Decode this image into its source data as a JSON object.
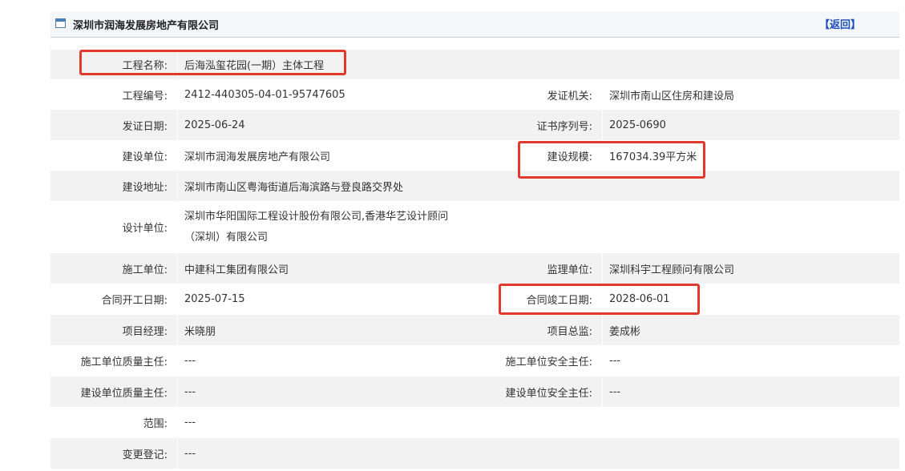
{
  "header": {
    "title": "深圳市润海发展房地产有限公司",
    "back_label": "【返回】"
  },
  "rows": [
    {
      "label1": "工程名称:",
      "value1": "后海泓玺花园(一期）主体工程"
    },
    {
      "label1": "工程编号:",
      "value1": "2412-440305-04-01-95747605",
      "label2": "发证机关:",
      "value2": "深圳市南山区住房和建设局"
    },
    {
      "label1": "发证日期:",
      "value1": "2025-06-24",
      "label2": "证书序列号:",
      "value2": "2025-0690"
    },
    {
      "label1": "建设单位:",
      "value1": "深圳市润海发展房地产有限公司",
      "label2": "建设规模:",
      "value2": "167034.39平方米"
    },
    {
      "label1": "建设地址:",
      "value1": "深圳市南山区粤海街道后海滨路与登良路交界处"
    },
    {
      "label1": "设计单位:",
      "value1_line1": "深圳市华阳国际工程设计股份有限公司,香港华艺设计顾问",
      "value1_line2": "（深圳）有限公司"
    },
    {
      "label1": "施工单位:",
      "value1": "中建科工集团有限公司",
      "label2": "监理单位:",
      "value2": "深圳科宇工程顾问有限公司"
    },
    {
      "label1": "合同开工日期:",
      "value1": "2025-07-15",
      "label2": "合同竣工日期:",
      "value2": "2028-06-01"
    },
    {
      "label1": "项目经理:",
      "value1": "米晓朋",
      "label2": "项目总监:",
      "value2": "姜成彬"
    },
    {
      "label1": "施工单位质量主任:",
      "value1": "---",
      "label2": "施工单位安全主任:",
      "value2": "---"
    },
    {
      "label1": "建设单位质量主任:",
      "value1": "---",
      "label2": "建设单位安全主任:",
      "value2": "---"
    },
    {
      "label1": "范围:",
      "value1": "---"
    },
    {
      "label1": "变更登记:",
      "value1": "---"
    }
  ],
  "highlight_color": "#e03a2e"
}
